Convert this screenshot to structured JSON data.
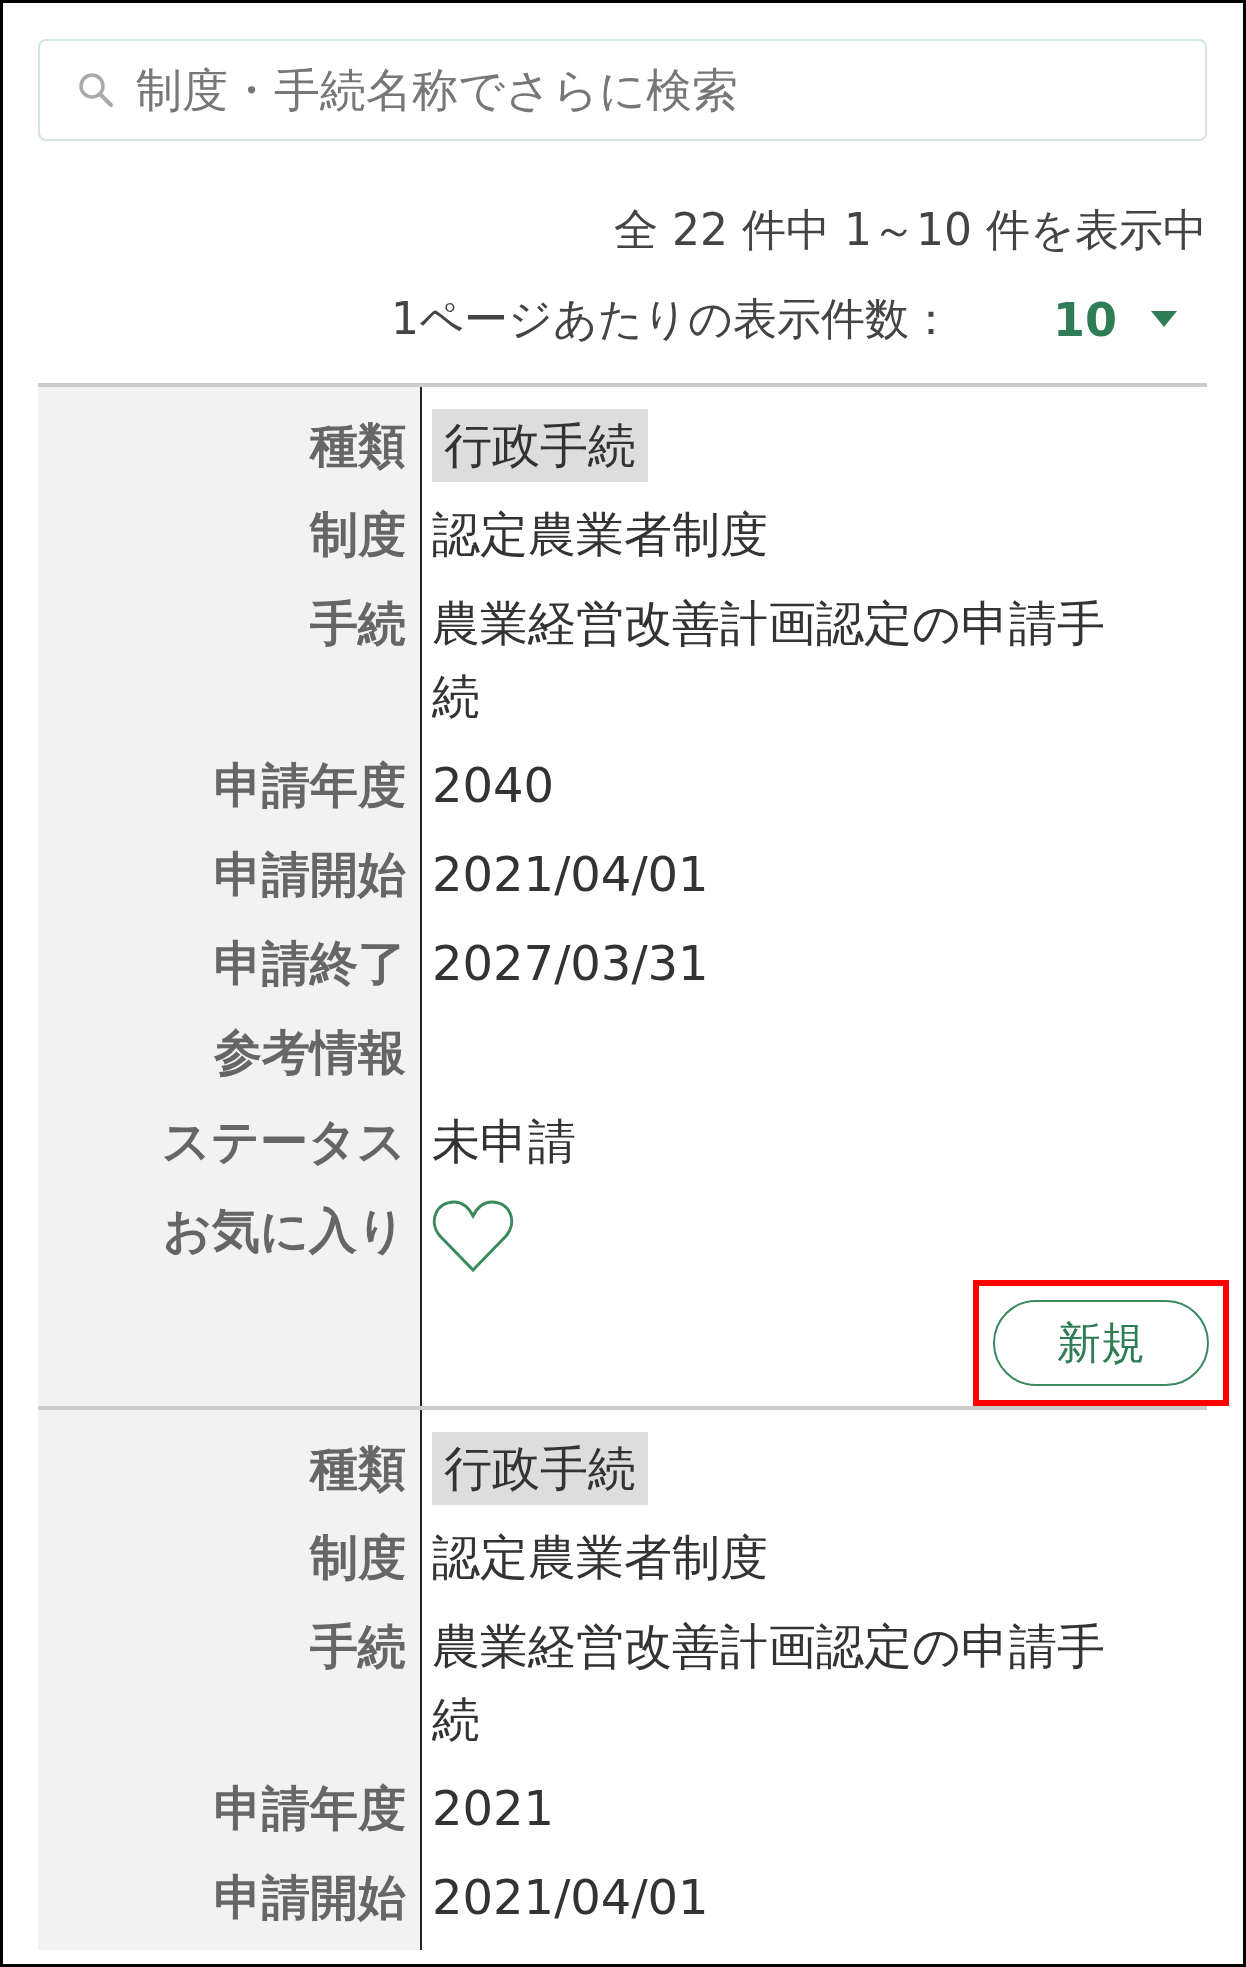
{
  "search": {
    "placeholder": "制度・手続名称でさらに検索"
  },
  "summary": "全 22 件中 1～10 件を表示中",
  "per_page": {
    "label": "1ページあたりの表示件数：",
    "value": "10"
  },
  "records": [
    {
      "fields": [
        {
          "label": "種類",
          "kind": "tag",
          "value": "行政手続"
        },
        {
          "label": "制度",
          "kind": "text",
          "value": "認定農業者制度"
        },
        {
          "label": "手続",
          "kind": "text",
          "value": "農業経営改善計画認定の申請手続"
        },
        {
          "label": "申請年度",
          "kind": "text",
          "value": "2040"
        },
        {
          "label": "申請開始",
          "kind": "text",
          "value": "2021/04/01"
        },
        {
          "label": "申請終了",
          "kind": "text",
          "value": "2027/03/31"
        },
        {
          "label": "参考情報",
          "kind": "text"
        },
        {
          "label": "ステータス",
          "kind": "text",
          "value": "未申請"
        },
        {
          "label": "お気に入り",
          "kind": "favorite",
          "on": false
        }
      ],
      "button": {
        "label": "新規",
        "highlighted": true
      }
    },
    {
      "fields": [
        {
          "label": "種類",
          "kind": "tag",
          "value": "行政手続"
        },
        {
          "label": "制度",
          "kind": "text",
          "value": "認定農業者制度"
        },
        {
          "label": "手続",
          "kind": "text",
          "value": "農業経営改善計画認定の申請手続"
        },
        {
          "label": "申請年度",
          "kind": "text",
          "value": "2021"
        },
        {
          "label": "申請開始",
          "kind": "text",
          "value": "2021/04/01"
        }
      ]
    }
  ]
}
